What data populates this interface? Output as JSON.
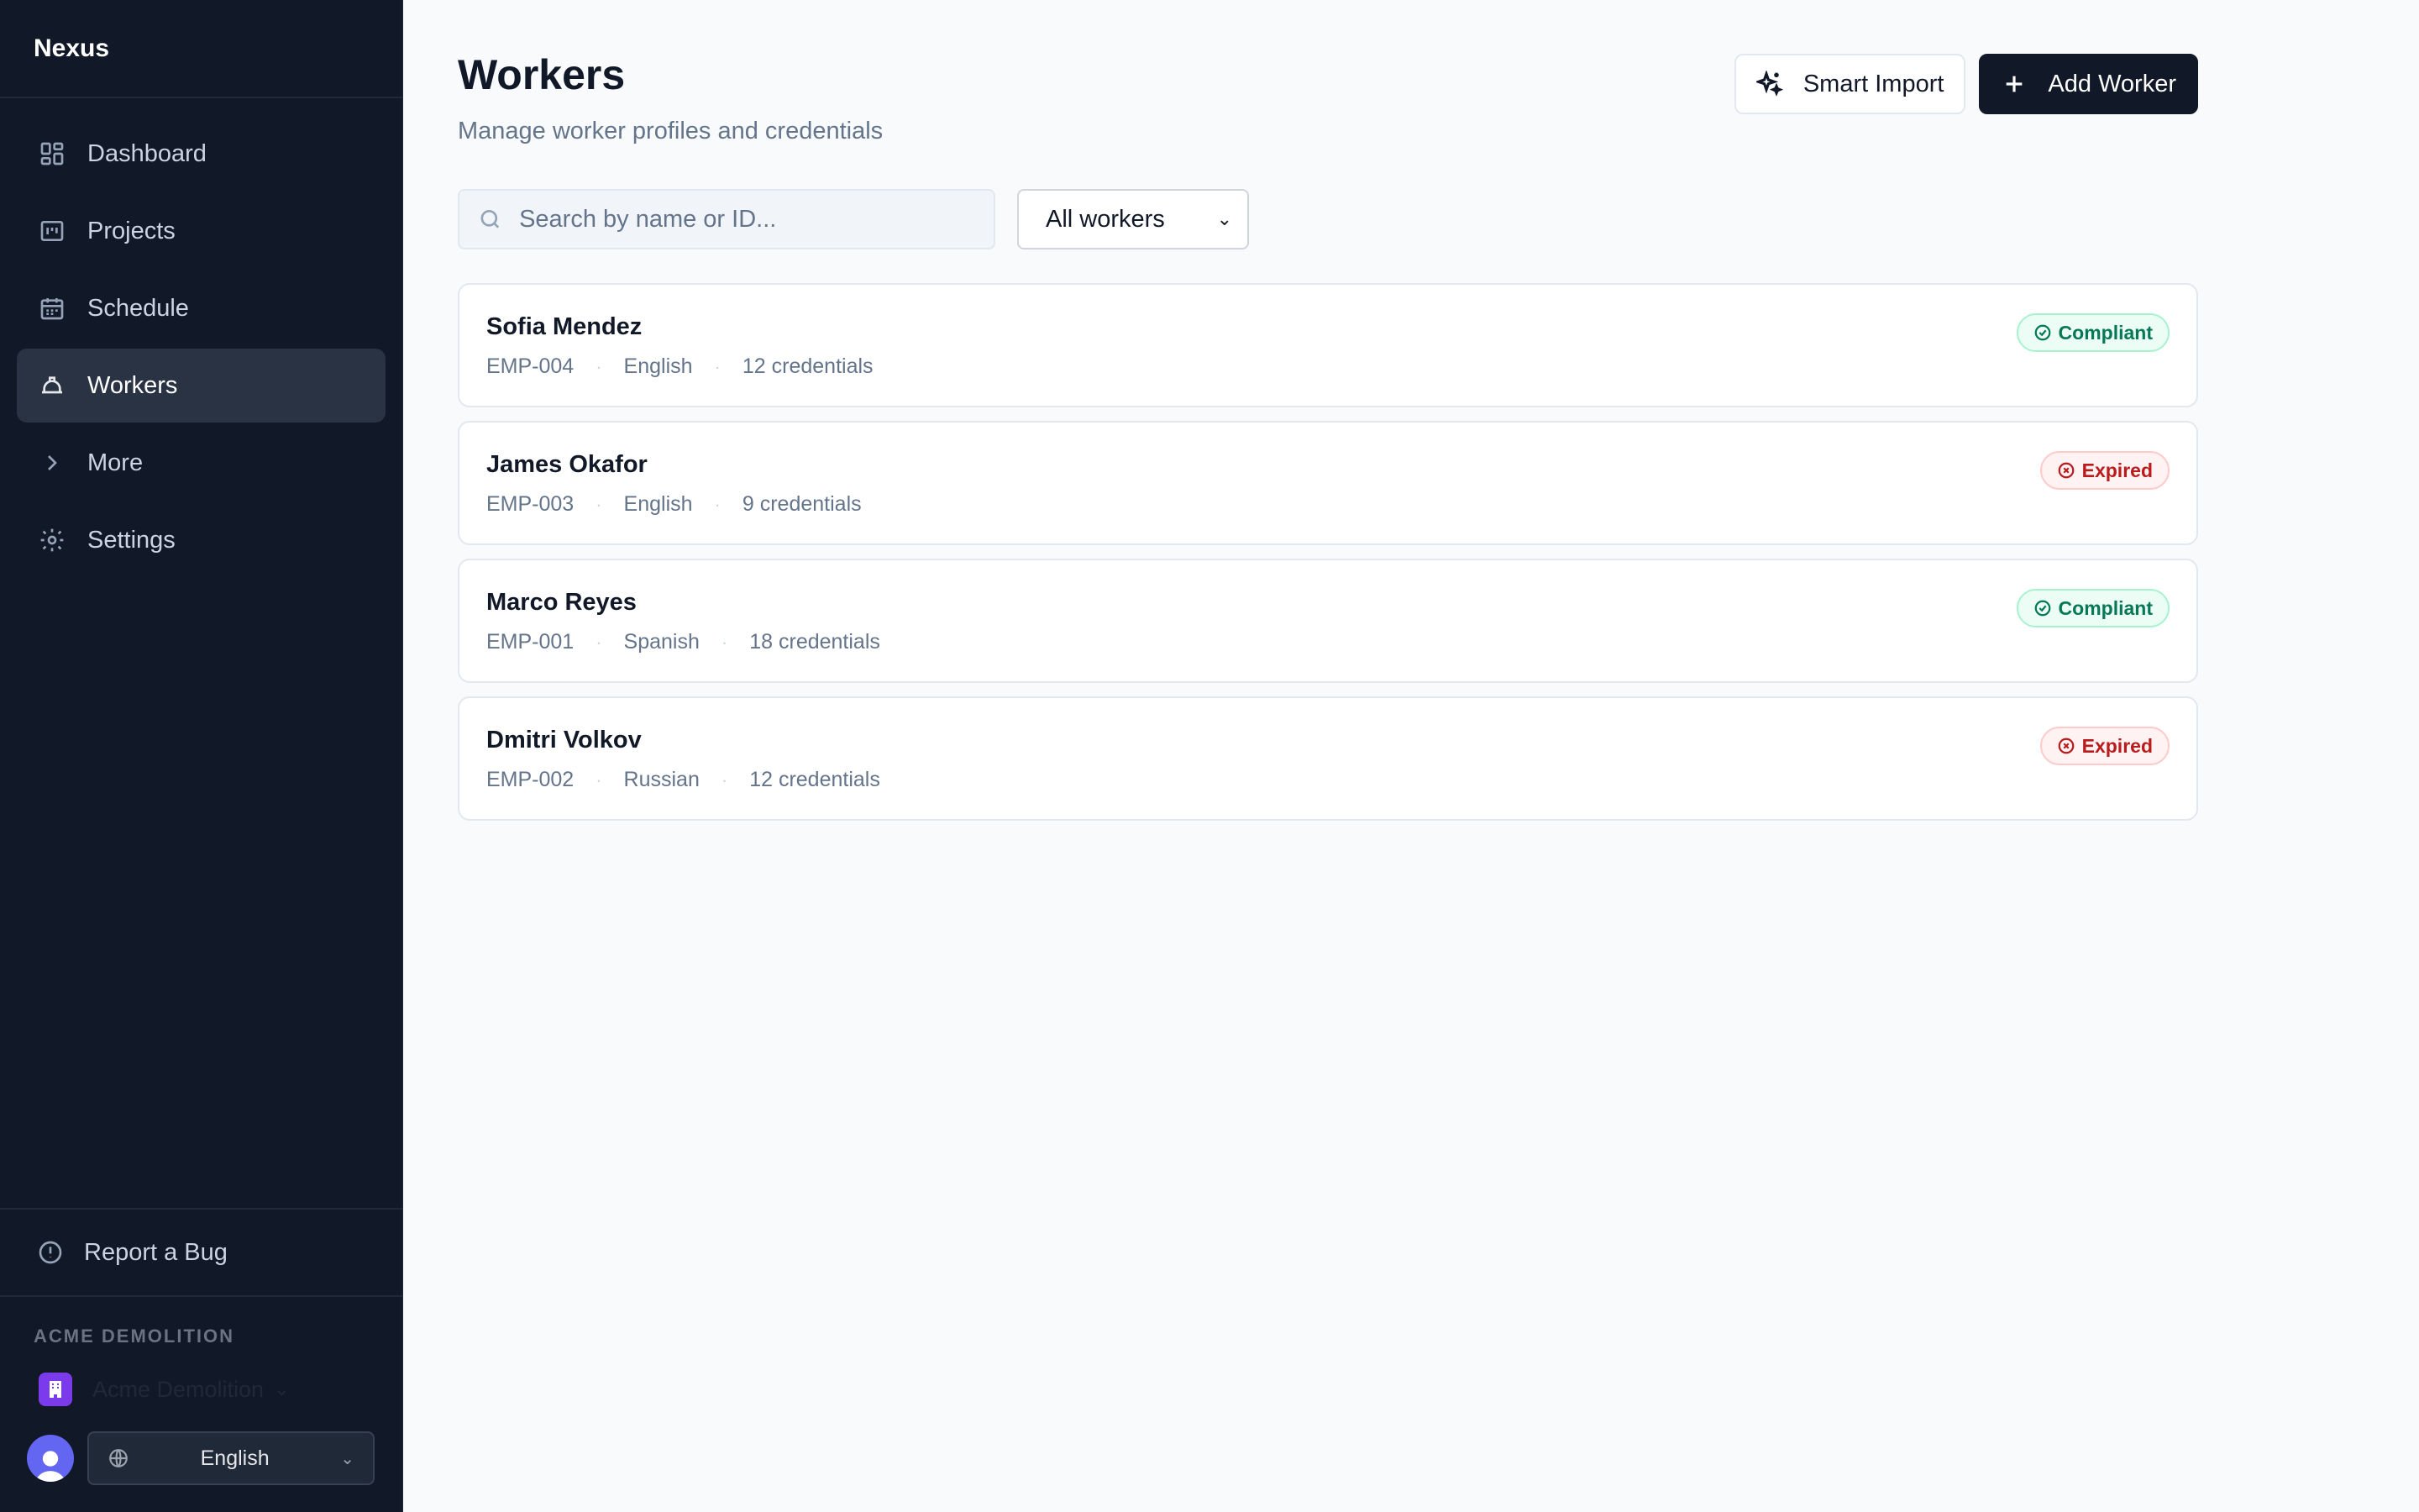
{
  "app": {
    "name": "Nexus"
  },
  "sidebar": {
    "items": [
      {
        "label": "Dashboard",
        "icon": "dashboard-icon",
        "active": false
      },
      {
        "label": "Projects",
        "icon": "projects-icon",
        "active": false
      },
      {
        "label": "Schedule",
        "icon": "calendar-icon",
        "active": false
      },
      {
        "label": "Workers",
        "icon": "hardhat-icon",
        "active": true
      },
      {
        "label": "More",
        "icon": "chevron-right-icon",
        "active": false
      },
      {
        "label": "Settings",
        "icon": "gear-icon",
        "active": false
      }
    ],
    "report_bug": "Report a Bug",
    "org_label": "ACME DEMOLITION",
    "org_name": "Acme Demolition",
    "language": "English"
  },
  "page": {
    "title": "Workers",
    "subtitle": "Manage worker profiles and credentials",
    "smart_import_label": "Smart Import",
    "add_worker_label": "Add Worker",
    "search_placeholder": "Search by name or ID...",
    "filter_selected": "All workers"
  },
  "workers": [
    {
      "name": "Sofia Mendez",
      "id": "EMP-004",
      "language": "English",
      "credentials": "12 credentials",
      "status": "Compliant"
    },
    {
      "name": "James Okafor",
      "id": "EMP-003",
      "language": "English",
      "credentials": "9 credentials",
      "status": "Expired"
    },
    {
      "name": "Marco Reyes",
      "id": "EMP-001",
      "language": "Spanish",
      "credentials": "18 credentials",
      "status": "Compliant"
    },
    {
      "name": "Dmitri Volkov",
      "id": "EMP-002",
      "language": "Russian",
      "credentials": "12 credentials",
      "status": "Expired"
    }
  ],
  "colors": {
    "sidebar_bg": "#111827",
    "primary": "#111827",
    "compliant": "#047857",
    "expired": "#b91c1c",
    "org_accent": "#7c3aed",
    "avatar": "#6366f1"
  }
}
